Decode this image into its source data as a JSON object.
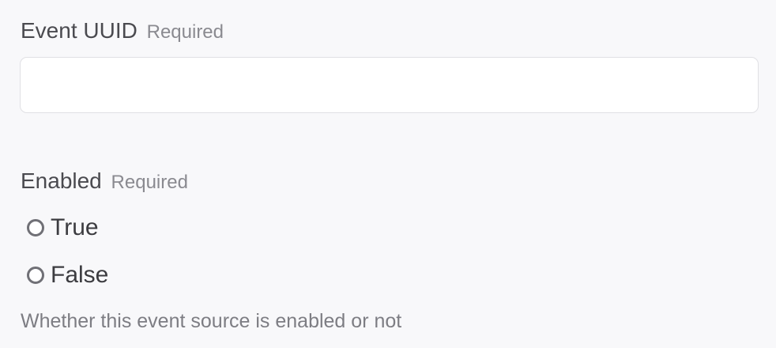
{
  "fields": {
    "event_uuid": {
      "label": "Event UUID",
      "required_tag": "Required",
      "value": "",
      "placeholder": ""
    },
    "enabled": {
      "label": "Enabled",
      "required_tag": "Required",
      "options": [
        {
          "label": "True",
          "selected": false
        },
        {
          "label": "False",
          "selected": false
        }
      ],
      "help_text": "Whether this event source is enabled or not"
    }
  },
  "colors": {
    "background": "#f8f8fa",
    "input_border": "#e0e0e4",
    "label": "#4a4a4f",
    "muted": "#8a8a90"
  }
}
